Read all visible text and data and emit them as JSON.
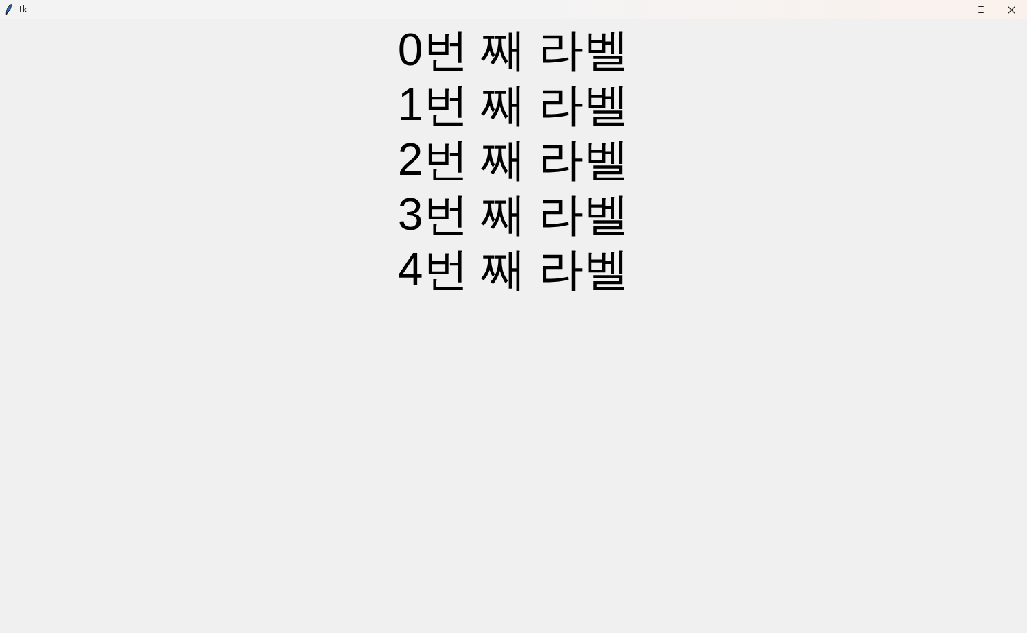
{
  "window": {
    "title": "tk"
  },
  "labels": [
    "0번 째 라벨",
    "1번 째 라벨",
    "2번 째 라벨",
    "3번 째 라벨",
    "4번 째 라벨"
  ]
}
